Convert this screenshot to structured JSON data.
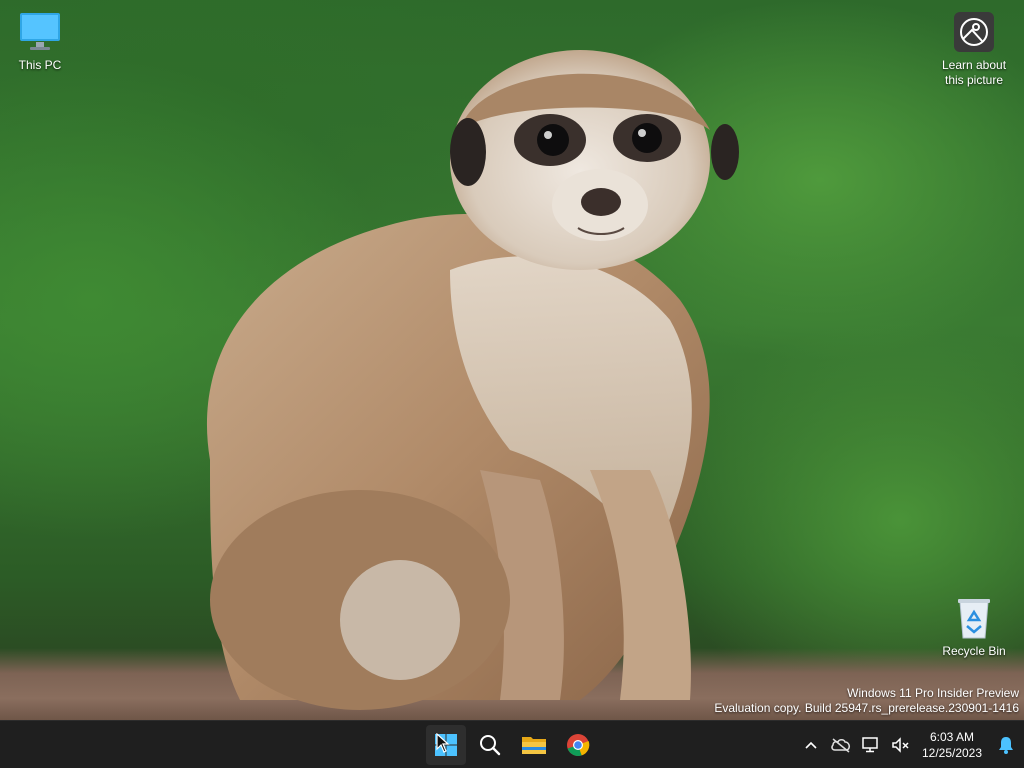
{
  "desktop": {
    "icons": {
      "this_pc": "This PC",
      "learn": "Learn about this picture",
      "recycle": "Recycle Bin"
    },
    "watermark": {
      "line1": "Windows 11 Pro Insider Preview",
      "line2": "Evaluation copy. Build 25947.rs_prerelease.230901-1416"
    }
  },
  "taskbar": {
    "apps": [
      "start-icon",
      "search-icon",
      "file-explorer-icon",
      "chrome-icon"
    ],
    "tray": {
      "time": "6:03 AM",
      "date": "12/25/2023"
    }
  },
  "colors": {
    "taskbar_bg": "#1f1f1f",
    "start_blue": "#4cc2ff",
    "folder_yellow": "#f4c542"
  }
}
